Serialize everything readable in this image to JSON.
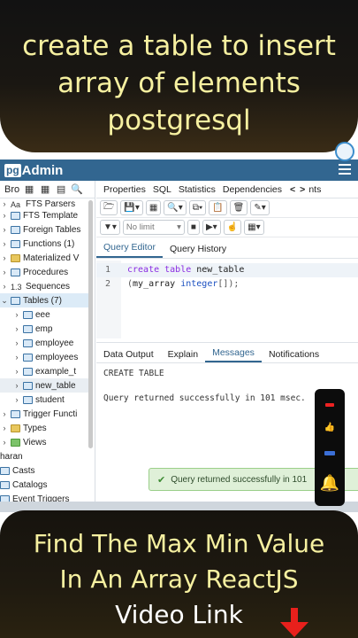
{
  "banner_top": {
    "line1": "create a table to insert",
    "line2": "array of elements",
    "line3": "postgresql"
  },
  "app": {
    "logo_pg": "pg",
    "logo_admin": "Admin"
  },
  "browser": {
    "label": "Bro",
    "tree": [
      {
        "label": "FTS Parsers",
        "prefix": "Aa"
      },
      {
        "label": "FTS Template"
      },
      {
        "label": "Foreign Tables"
      },
      {
        "label": "Functions (1)"
      },
      {
        "label": "Materialized V"
      },
      {
        "label": "Procedures"
      },
      {
        "label": "Sequences",
        "prefix": "1.3"
      },
      {
        "label": "Tables (7)"
      },
      {
        "label": "eee"
      },
      {
        "label": "emp"
      },
      {
        "label": "employee"
      },
      {
        "label": "employees"
      },
      {
        "label": "example_t"
      },
      {
        "label": "new_table"
      },
      {
        "label": "student"
      },
      {
        "label": "Trigger Functi"
      },
      {
        "label": "Types"
      },
      {
        "label": "Views"
      },
      {
        "label": "haran"
      },
      {
        "label": "Casts"
      },
      {
        "label": "Catalogs"
      },
      {
        "label": "Event Triggers"
      }
    ]
  },
  "tabs": [
    "Properties",
    "SQL",
    "Statistics",
    "Dependencies",
    "nts"
  ],
  "toolbar": {
    "limit_label": "No limit"
  },
  "query_tabs": [
    "Query Editor",
    "Query History"
  ],
  "editor": {
    "lines": [
      {
        "num": "1",
        "kw": "create table",
        "rest": " new_table"
      },
      {
        "num": "2",
        "open": "(",
        "col": "my_array",
        "type": " integer",
        "close": "[]);"
      }
    ]
  },
  "output_tabs": [
    "Data Output",
    "Explain",
    "Messages",
    "Notifications"
  ],
  "messages": {
    "line1": "CREATE TABLE",
    "line2": "Query returned successfully in 101 msec."
  },
  "toast": {
    "text": "Query returned successfully in 101"
  },
  "banner_bottom": {
    "line1": "Find The Max Min Value",
    "line2": "In An Array ReactJS",
    "line3": "Video Link"
  },
  "colors": {
    "header": "#326690",
    "banner_text": "#f6f0a0",
    "toast_bg": "#dff0d8"
  }
}
